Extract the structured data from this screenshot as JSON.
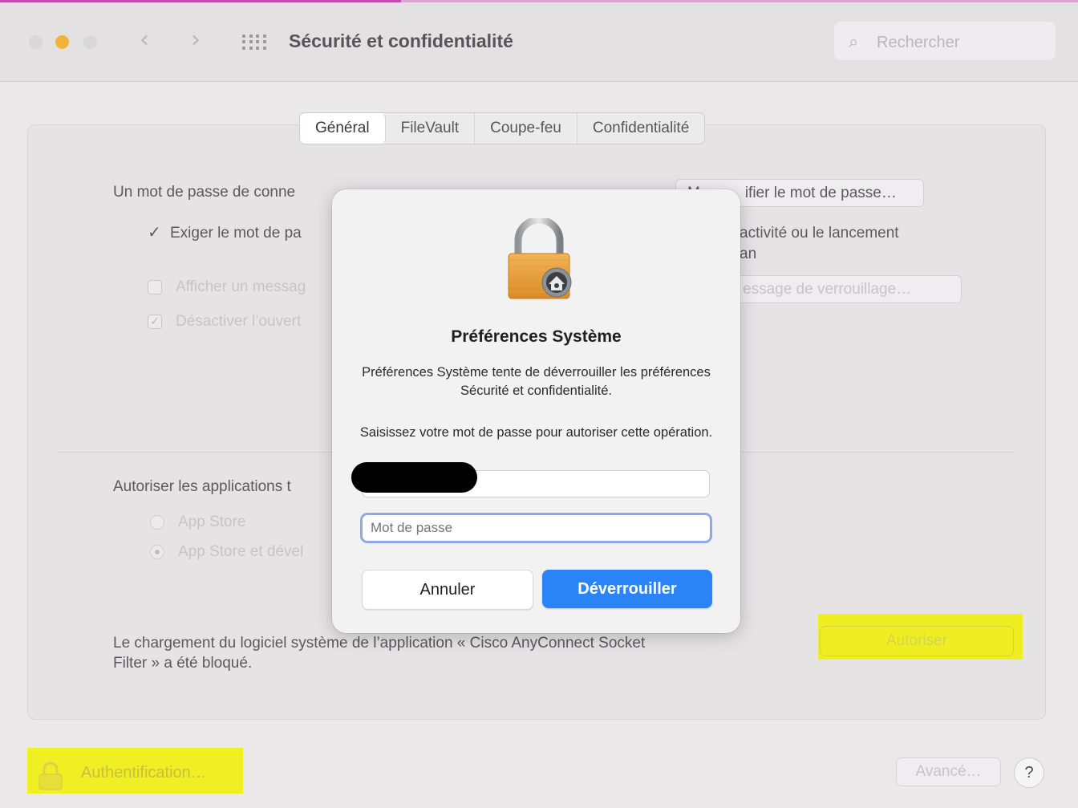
{
  "window": {
    "title": "Sécurité et confidentialité",
    "search_placeholder": "Rechercher"
  },
  "tabs": [
    {
      "label": "Général",
      "active": true
    },
    {
      "label": "FileVault",
      "active": false
    },
    {
      "label": "Coupe-feu",
      "active": false
    },
    {
      "label": "Confidentialité",
      "active": false
    }
  ],
  "general": {
    "password_text": "Un mot de passe de conne",
    "change_password_button": "Modifier le mot de passe…",
    "change_password_visible": "M",
    "change_password_visible2": "ifier le mot de passe…",
    "require_password_label": "Exiger le mot de pa",
    "require_password_suffix1": "activité ou le lancement",
    "require_password_suffix2": "an",
    "show_message_label": "Afficher un messag",
    "lock_message_button": "essage de verrouillage…",
    "disable_auto_login_label": "Désactiver l’ouvert",
    "allow_apps_label": "Autoriser les applications t",
    "radio_app_store": "App Store",
    "radio_app_store_dev": "App Store et dével",
    "blocked_line1": "Le chargement du logiciel système de l’application « Cisco AnyConnect Socket",
    "blocked_line2": "Filter » a été bloqué.",
    "autoriser_button": "Autoriser"
  },
  "footer": {
    "auth_label": "Authentification…",
    "advanced_button": "Avancé…",
    "help_button": "?"
  },
  "dialog": {
    "title": "Préférences Système",
    "message1": "Préférences Système tente de déverrouiller les préférences Sécurité et confidentialité.",
    "message2": "Saisissez votre mot de passe pour autoriser cette opération.",
    "password_placeholder": "Mot de passe",
    "cancel_button": "Annuler",
    "unlock_button": "Déverrouiller"
  },
  "colors": {
    "accent": "#2b84f5",
    "highlight": "#f0f000"
  }
}
